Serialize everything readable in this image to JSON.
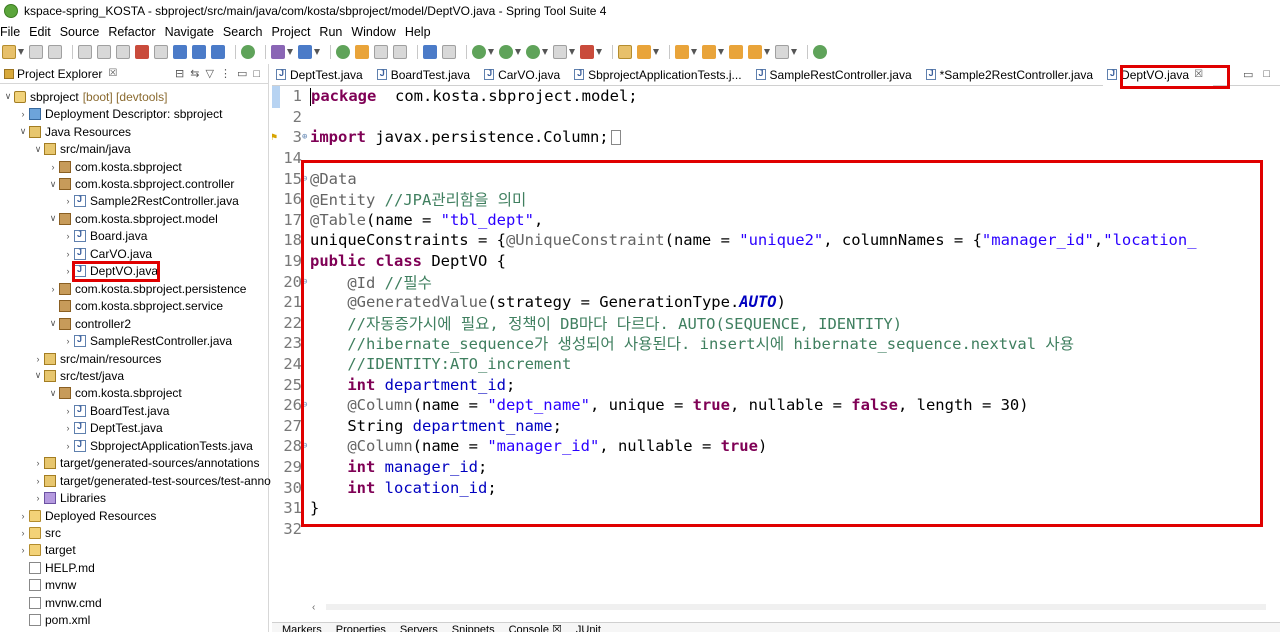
{
  "window": {
    "title": "kspace-spring_KOSTA - sbproject/src/main/java/com/kosta/sbproject/model/DeptVO.java - Spring Tool Suite 4"
  },
  "menu": [
    "File",
    "Edit",
    "Source",
    "Refactor",
    "Navigate",
    "Search",
    "Project",
    "Run",
    "Window",
    "Help"
  ],
  "explorer": {
    "tab_label": "Project Explorer",
    "tab_close": "☒",
    "tree": [
      {
        "label": "sbproject",
        "suffix": "[boot] [devtools]",
        "arrow": "∨",
        "icon": "project-icon",
        "indent": 0
      },
      {
        "label": "Deployment Descriptor: sbproject",
        "arrow": "›",
        "icon": "descriptor-icon",
        "indent": 1
      },
      {
        "label": "Java Resources",
        "arrow": "∨",
        "icon": "java-resources-icon",
        "indent": 1
      },
      {
        "label": "src/main/java",
        "arrow": "∨",
        "icon": "source-folder-icon",
        "indent": 2
      },
      {
        "label": "com.kosta.sbproject",
        "arrow": "›",
        "icon": "package-icon",
        "indent": 3
      },
      {
        "label": "com.kosta.sbproject.controller",
        "arrow": "∨",
        "icon": "package-icon",
        "indent": 3
      },
      {
        "label": "Sample2RestController.java",
        "arrow": "›",
        "icon": "java-file-icon",
        "indent": 4
      },
      {
        "label": "com.kosta.sbproject.model",
        "arrow": "∨",
        "icon": "package-icon",
        "indent": 3
      },
      {
        "label": "Board.java",
        "arrow": "›",
        "icon": "java-file-icon",
        "indent": 4
      },
      {
        "label": "CarVO.java",
        "arrow": "›",
        "icon": "java-file-icon",
        "indent": 4
      },
      {
        "label": "DeptVO.java",
        "arrow": "›",
        "icon": "java-file-icon",
        "indent": 4
      },
      {
        "label": "com.kosta.sbproject.persistence",
        "arrow": "›",
        "icon": "package-icon",
        "indent": 3
      },
      {
        "label": "com.kosta.sbproject.service",
        "arrow": "",
        "icon": "package-icon",
        "indent": 3
      },
      {
        "label": "controller2",
        "arrow": "∨",
        "icon": "package-icon",
        "indent": 3
      },
      {
        "label": "SampleRestController.java",
        "arrow": "›",
        "icon": "java-file-icon",
        "indent": 4
      },
      {
        "label": "src/main/resources",
        "arrow": "›",
        "icon": "source-folder-icon",
        "indent": 2
      },
      {
        "label": "src/test/java",
        "arrow": "∨",
        "icon": "source-folder-icon",
        "indent": 2
      },
      {
        "label": "com.kosta.sbproject",
        "arrow": "∨",
        "icon": "package-icon",
        "indent": 3
      },
      {
        "label": "BoardTest.java",
        "arrow": "›",
        "icon": "java-file-icon",
        "indent": 4
      },
      {
        "label": "DeptTest.java",
        "arrow": "›",
        "icon": "java-file-icon",
        "indent": 4
      },
      {
        "label": "SbprojectApplicationTests.java",
        "arrow": "›",
        "icon": "java-file-icon",
        "indent": 4
      },
      {
        "label": "target/generated-sources/annotations",
        "arrow": "›",
        "icon": "source-folder-icon",
        "indent": 2
      },
      {
        "label": "target/generated-test-sources/test-anno",
        "arrow": "›",
        "icon": "source-folder-icon",
        "indent": 2
      },
      {
        "label": "Libraries",
        "arrow": "›",
        "icon": "library-icon",
        "indent": 2
      },
      {
        "label": "Deployed Resources",
        "arrow": "›",
        "icon": "folder-icon",
        "indent": 1
      },
      {
        "label": "src",
        "arrow": "›",
        "icon": "folder-icon",
        "indent": 1
      },
      {
        "label": "target",
        "arrow": "›",
        "icon": "folder-icon",
        "indent": 1
      },
      {
        "label": "HELP.md",
        "arrow": "",
        "icon": "file-icon",
        "indent": 1
      },
      {
        "label": "mvnw",
        "arrow": "",
        "icon": "file-icon",
        "indent": 1
      },
      {
        "label": "mvnw.cmd",
        "arrow": "",
        "icon": "file-icon",
        "indent": 1
      },
      {
        "label": "pom.xml",
        "arrow": "",
        "icon": "file-icon",
        "indent": 1
      }
    ]
  },
  "editor": {
    "tabs": [
      {
        "label": "DeptTest.java"
      },
      {
        "label": "BoardTest.java"
      },
      {
        "label": "CarVO.java"
      },
      {
        "label": "SbprojectApplicationTests.j..."
      },
      {
        "label": "SampleRestController.java"
      },
      {
        "label": "*Sample2RestController.java"
      },
      {
        "label": "DeptVO.java",
        "active": true,
        "close": "☒"
      }
    ],
    "lines": [
      {
        "n": "1",
        "segs": [
          [
            "kw",
            "package"
          ],
          [
            "",
            "  com.kosta.sbproject.model;"
          ]
        ]
      },
      {
        "n": "2",
        "segs": []
      },
      {
        "n": "3",
        "fold": "+",
        "segs": [
          [
            "kw",
            "import"
          ],
          [
            "",
            " javax.persistence.Column;"
          ]
        ]
      },
      {
        "n": "14",
        "segs": []
      },
      {
        "n": "15",
        "fold": "-",
        "segs": [
          [
            "an",
            "@Data"
          ]
        ]
      },
      {
        "n": "16",
        "segs": [
          [
            "an",
            "@Entity"
          ],
          [
            "cm",
            " //JPA관리함을 의미"
          ]
        ]
      },
      {
        "n": "17",
        "segs": [
          [
            "an",
            "@Table"
          ],
          [
            "",
            "(name = "
          ],
          [
            "str",
            "\"tbl_dept\""
          ],
          [
            "",
            ","
          ]
        ]
      },
      {
        "n": "18",
        "segs": [
          [
            "",
            "uniqueConstraints = {"
          ],
          [
            "an",
            "@UniqueConstraint"
          ],
          [
            "",
            "(name = "
          ],
          [
            "str",
            "\"unique2\""
          ],
          [
            "",
            ", columnNames = {"
          ],
          [
            "str",
            "\"manager_id\""
          ],
          [
            "",
            ","
          ],
          [
            "str",
            "\"location_"
          ]
        ]
      },
      {
        "n": "19",
        "segs": [
          [
            "kw",
            "public class"
          ],
          [
            "",
            " DeptVO {"
          ]
        ]
      },
      {
        "n": "20",
        "fold": "-",
        "segs": [
          [
            "",
            "    "
          ],
          [
            "an",
            "@Id"
          ],
          [
            "cm",
            " //필수"
          ]
        ]
      },
      {
        "n": "21",
        "segs": [
          [
            "",
            "    "
          ],
          [
            "an",
            "@GeneratedValue"
          ],
          [
            "",
            "(strategy = GenerationType."
          ],
          [
            "ital",
            "AUTO"
          ],
          [
            "",
            ")"
          ]
        ]
      },
      {
        "n": "22",
        "segs": [
          [
            "cm",
            "    //자동증가시에 필요, 정책이 DB마다 다르다. AUTO(SEQUENCE, IDENTITY)"
          ]
        ]
      },
      {
        "n": "23",
        "segs": [
          [
            "cm",
            "    //hibernate_sequence가 생성되어 사용된다. insert시에 hibernate_sequence.nextval 사용"
          ]
        ]
      },
      {
        "n": "24",
        "segs": [
          [
            "cm",
            "    //IDENTITY:ATO_increment"
          ]
        ]
      },
      {
        "n": "25",
        "segs": [
          [
            "",
            "    "
          ],
          [
            "kw",
            "int"
          ],
          [
            "",
            " "
          ],
          [
            "fld",
            "department_id"
          ],
          [
            "",
            ";"
          ]
        ]
      },
      {
        "n": "26",
        "fold": "-",
        "segs": [
          [
            "",
            "    "
          ],
          [
            "an",
            "@Column"
          ],
          [
            "",
            "(name = "
          ],
          [
            "str",
            "\"dept_name\""
          ],
          [
            "",
            ", unique = "
          ],
          [
            "kw",
            "true"
          ],
          [
            "",
            ", nullable = "
          ],
          [
            "kw",
            "false"
          ],
          [
            "",
            ", length = 30)"
          ]
        ]
      },
      {
        "n": "27",
        "segs": [
          [
            "",
            "    String "
          ],
          [
            "fld",
            "department_name"
          ],
          [
            "",
            ";"
          ]
        ]
      },
      {
        "n": "28",
        "fold": "-",
        "segs": [
          [
            "",
            "    "
          ],
          [
            "an",
            "@Column"
          ],
          [
            "",
            "(name = "
          ],
          [
            "str",
            "\"manager_id\""
          ],
          [
            "",
            ", nullable = "
          ],
          [
            "kw",
            "true"
          ],
          [
            "",
            ")"
          ]
        ]
      },
      {
        "n": "29",
        "segs": [
          [
            "",
            "    "
          ],
          [
            "kw",
            "int"
          ],
          [
            "",
            " "
          ],
          [
            "fld",
            "manager_id"
          ],
          [
            "",
            ";"
          ]
        ]
      },
      {
        "n": "30",
        "segs": [
          [
            "",
            "    "
          ],
          [
            "kw",
            "int"
          ],
          [
            "",
            " "
          ],
          [
            "fld",
            "location_id"
          ],
          [
            "",
            ";"
          ]
        ]
      },
      {
        "n": "31",
        "segs": [
          [
            "",
            "}"
          ]
        ]
      },
      {
        "n": "32",
        "segs": []
      }
    ]
  },
  "bottom_tabs": [
    "Markers",
    "Properties",
    "Servers",
    "Snippets",
    "Console ☒",
    "JUnit"
  ],
  "colors": {
    "highlight": "#e00000",
    "keyword": "#7f0055",
    "string": "#2a00ff",
    "comment": "#3f7f5f",
    "field": "#0000c0"
  }
}
